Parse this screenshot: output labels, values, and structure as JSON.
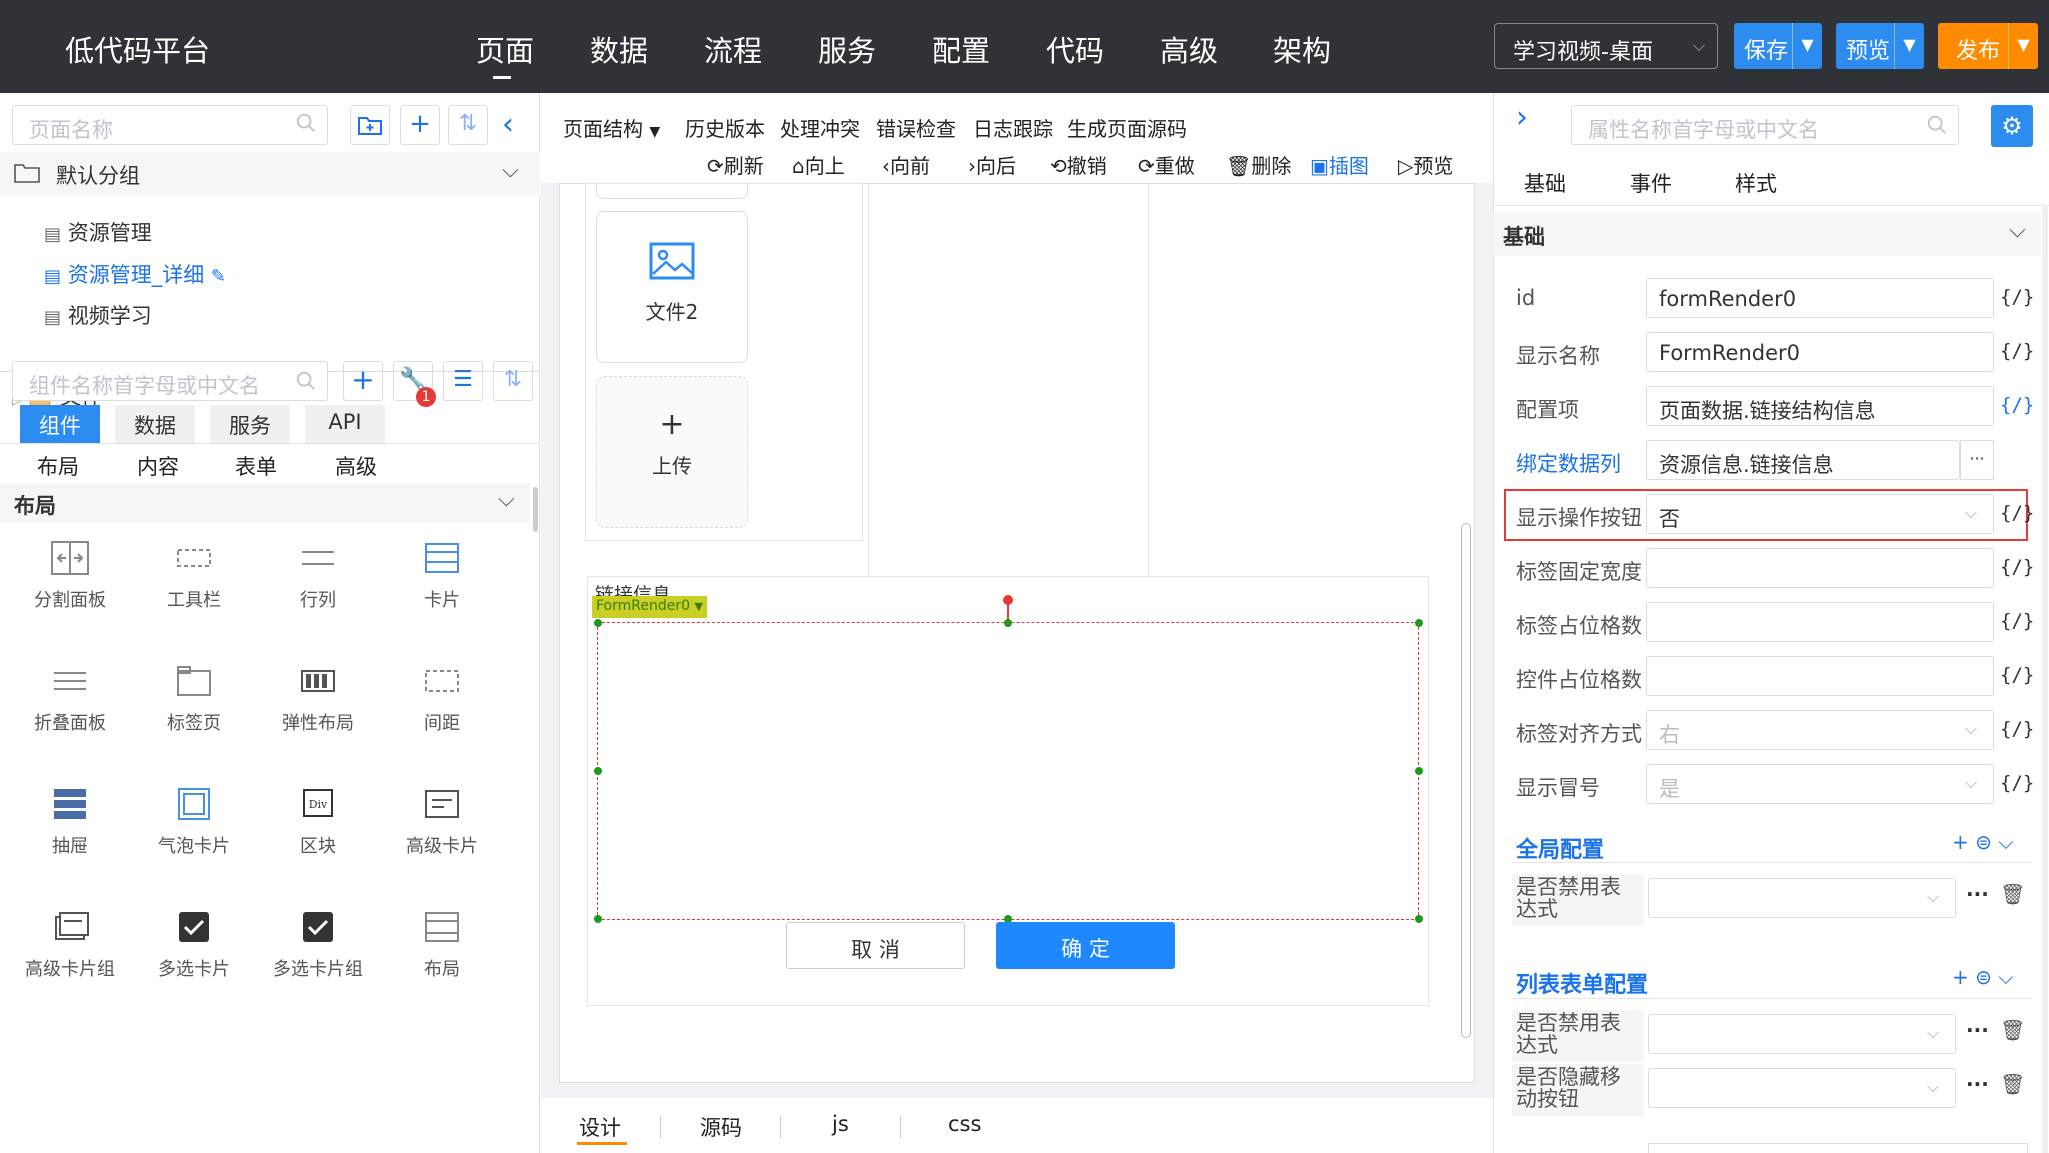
{
  "topbar": {
    "app_title": "低代码平台",
    "nav": [
      "页面",
      "数据",
      "流程",
      "服务",
      "配置",
      "代码",
      "高级",
      "架构"
    ],
    "view_select": "学习视频-桌面",
    "save_label": "保存",
    "preview_label": "预览",
    "publish_label": "发布"
  },
  "left": {
    "page_search_placeholder": "页面名称",
    "group_label": "默认分组",
    "pages": [
      "资源管理",
      "资源管理_详细",
      "视频学习"
    ],
    "folder_label": "文件",
    "comp_search_placeholder": "组件名称首字母或中文名",
    "badge_count": "1",
    "main_tabs": [
      "组件",
      "数据",
      "服务",
      "API"
    ],
    "sub_tabs": [
      "布局",
      "内容",
      "表单",
      "高级"
    ],
    "layout_section_title": "布局",
    "components": [
      "分割面板",
      "工具栏",
      "行列",
      "卡片",
      "折叠面板",
      "标签页",
      "弹性布局",
      "间距",
      "抽屉",
      "气泡卡片",
      "区块",
      "高级卡片",
      "高级卡片组",
      "多选卡片",
      "多选卡片组",
      "布局"
    ],
    "div_icon_text": "Div"
  },
  "middle": {
    "toolbar1": [
      "页面结构",
      "历史版本",
      "处理冲突",
      "错误检查",
      "日志跟踪",
      "生成页面源码"
    ],
    "toolbar2": [
      "刷新",
      "向上",
      "向前",
      "向后",
      "撤销",
      "重做",
      "删除",
      "插图",
      "预览"
    ],
    "file_card_label": "文件2",
    "upload_label": "上传",
    "section_title": "链接信息",
    "selected_tag": "FormRender0",
    "cancel_label": "取 消",
    "confirm_label": "确 定",
    "bottom_tabs": [
      "设计",
      "源码",
      "js",
      "css"
    ]
  },
  "right": {
    "search_placeholder": "属性名称首字母或中文名",
    "tabs": [
      "基础",
      "事件",
      "样式"
    ],
    "section_basic": "基础",
    "props": [
      {
        "label": "id",
        "value": "formRender0",
        "brace": "{/}"
      },
      {
        "label": "显示名称",
        "value": "FormRender0",
        "brace": "{/}"
      },
      {
        "label": "配置项",
        "value": "页面数据.链接结构信息",
        "brace": "{/}"
      },
      {
        "label": "绑定数据列",
        "value": "资源信息.链接信息",
        "brace": "···"
      },
      {
        "label": "显示操作按钮",
        "value": "否",
        "brace": "{/}"
      },
      {
        "label": "标签固定宽度",
        "value": "",
        "brace": "{/}"
      },
      {
        "label": "标签占位格数",
        "value": "",
        "brace": "{/}"
      },
      {
        "label": "控件占位格数",
        "value": "",
        "brace": "{/}"
      },
      {
        "label": "标签对齐方式",
        "value": "右",
        "brace": "{/}"
      },
      {
        "label": "显示冒号",
        "value": "是",
        "brace": "{/}"
      }
    ],
    "global_config_title": "全局配置",
    "global_rows": [
      {
        "label": "是否禁用表达式"
      }
    ],
    "list_config_title": "列表表单配置",
    "list_rows": [
      {
        "label": "是否禁用表达式"
      },
      {
        "label": "是否隐藏移动按钮"
      }
    ]
  },
  "colors": {
    "accent": "#1a73e8",
    "topbar": "#2f3237",
    "publish": "#ff8c00",
    "highlight_border": "#e53935"
  }
}
